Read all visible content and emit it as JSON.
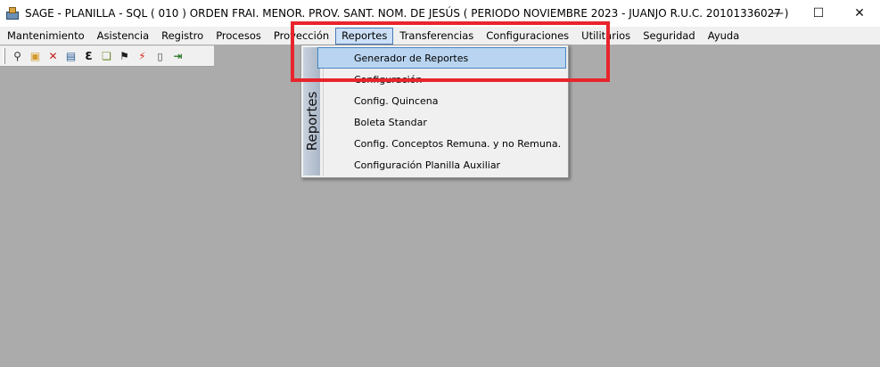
{
  "window": {
    "title": "SAGE - PLANILLA - SQL  ( 010 ) ORDEN FRAI. MENOR. PROV. SANT. NOM. DE JESÚS ( PERIODO NOVIEMBRE 2023 - JUANJO  R.U.C. 20101336027 )",
    "minimize": "—",
    "maximize": "☐",
    "close": "✕"
  },
  "menu": {
    "items": [
      "Mantenimiento",
      "Asistencia",
      "Registro",
      "Procesos",
      "Proyección",
      "Reportes",
      "Transferencias",
      "Configuraciones",
      "Utilitarios",
      "Seguridad",
      "Ayuda"
    ],
    "active_index": 5
  },
  "toolbar": {
    "icons": [
      "search-person-icon",
      "package-icon",
      "x-mark-icon",
      "table-icon",
      "e-letter-icon",
      "book-icon",
      "running-man-icon",
      "lightning-icon",
      "document-icon",
      "exit-door-icon"
    ],
    "glyphs": [
      "⚲",
      "▣",
      "✕",
      "▤",
      "Ɛ",
      "❏",
      "⚑",
      "⚡",
      "▯",
      "⇥"
    ]
  },
  "dropdown": {
    "sidebar_label": "Reportes",
    "items": [
      "Generador de Reportes",
      "Configuración",
      "Config. Quincena",
      "Boleta Standar",
      "Config. Conceptos Remuna. y no Remuna.",
      "Configuración Planilla Auxiliar"
    ],
    "selected_index": 0
  },
  "colors": {
    "workspace": "#ababab",
    "menu_active": "#cce0f7",
    "item_selected": "#b8d4f0",
    "annotation_red": "#e8242c"
  }
}
